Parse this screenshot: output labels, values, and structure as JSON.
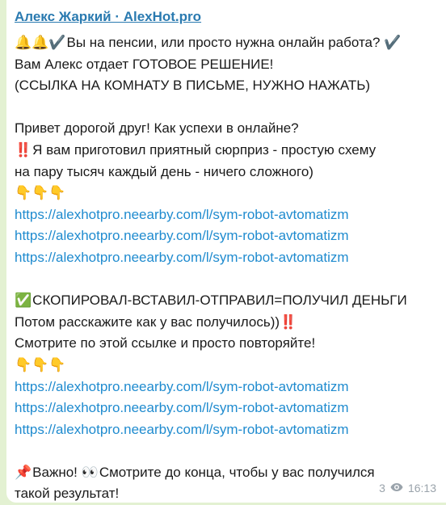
{
  "channel": {
    "name": "Алекс Жаркий · AlexHot.pro"
  },
  "message": {
    "line1_emojis": "🔔🔔✔️",
    "line1_text": "Вы на пенсии, или просто нужна онлайн работа?",
    "line1_end_emoji": "✔️",
    "line2": "Вам Алекс отдает ГОТОВОЕ РЕШЕНИЕ!",
    "line3": "(ССЫЛКА НА КОМНАТУ В ПИСЬМЕ, НУЖНО НАЖАТЬ)",
    "line4": "Привет дорогой друг! Как успехи в онлайне?",
    "line5_emoji": "‼️",
    "line5_text": "Я вам приготовил приятный сюрприз - простую схему",
    "line6": "на пару тысяч каждый день - ничего сложного)",
    "pointers1": "👇👇👇",
    "links1": [
      "https://alexhotpro.neearby.com/l/sym-robot-avtomatizm",
      "https://alexhotpro.neearby.com/l/sym-robot-avtomatizm",
      "https://alexhotpro.neearby.com/l/sym-robot-avtomatizm"
    ],
    "line7_emoji": "✅",
    "line7_text": "СКОПИРОВАЛ-ВСТАВИЛ-ОТПРАВИЛ=ПОЛУЧИЛ ДЕНЬГИ",
    "line8_text": "Потом расскажите как у вас получилось))",
    "line8_emoji": "‼️",
    "line9": "Смотрите по этой ссылке и просто повторяйте!",
    "pointers2": "👇👇👇",
    "links2": [
      "https://alexhotpro.neearby.com/l/sym-robot-avtomatizm",
      "https://alexhotpro.neearby.com/l/sym-robot-avtomatizm",
      "https://alexhotpro.neearby.com/l/sym-robot-avtomatizm"
    ],
    "line10_emoji1": "📌",
    "line10_text1": "Важно!",
    "line10_emoji2": "👀",
    "line10_text2": "Смотрите до конца, чтобы у вас получился",
    "line11": "такой результат!"
  },
  "meta": {
    "views": "3",
    "time": "16:13"
  }
}
